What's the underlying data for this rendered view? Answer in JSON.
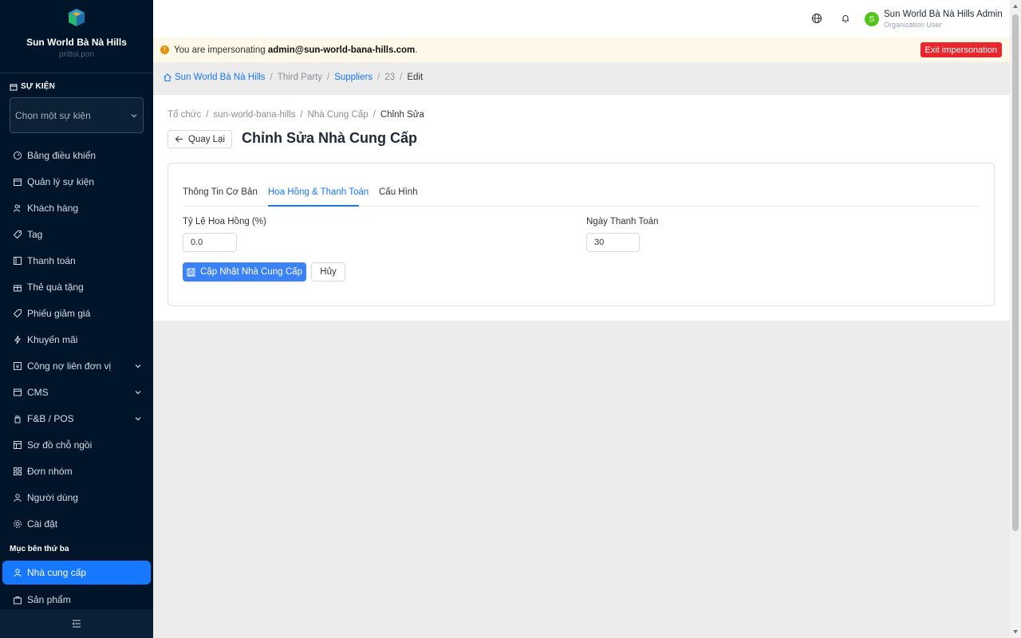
{
  "brand": {
    "name": "Sun World Bà Nà Hills",
    "sub": "prittoi.pon"
  },
  "event": {
    "section_label": "SỰ KIỆN",
    "select_placeholder": "Chọn một sự kiện"
  },
  "menu": {
    "items": [
      {
        "label": "Bảng điều khiển",
        "icon": "dashboard-icon"
      },
      {
        "label": "Quản lý sự kiện",
        "icon": "calendar-icon"
      },
      {
        "label": "Khách hàng",
        "icon": "users-icon"
      },
      {
        "label": "Tag",
        "icon": "tag-icon"
      },
      {
        "label": "Thanh toán",
        "icon": "payment-icon"
      },
      {
        "label": "Thẻ quà tặng",
        "icon": "gift-icon"
      },
      {
        "label": "Phiếu giảm giá",
        "icon": "coupon-icon"
      },
      {
        "label": "Khuyến mãi",
        "icon": "bolt-icon"
      },
      {
        "label": "Công nợ liên đơn vị",
        "icon": "ledger-icon"
      },
      {
        "label": "CMS",
        "icon": "cms-icon"
      },
      {
        "label": "F&B / POS",
        "icon": "hand-icon"
      },
      {
        "label": "Sơ đồ chỗ ngồi",
        "icon": "layout-icon"
      },
      {
        "label": "Đơn nhóm",
        "icon": "grid-icon"
      },
      {
        "label": "Người dùng",
        "icon": "user-icon"
      },
      {
        "label": "Cài đặt",
        "icon": "gear-icon"
      }
    ],
    "third_party_section": "Mục bên thứ ba",
    "third_party_items": [
      {
        "label": "Nhà cung cấp",
        "icon": "user-icon"
      },
      {
        "label": "Sản phẩm",
        "icon": "bag-icon"
      }
    ]
  },
  "header": {
    "user_initial": "S",
    "user_name": "Sun World Bà Nà Hills Admin",
    "user_role": "Organization User"
  },
  "impersonation": {
    "prefix": "You are impersonating ",
    "email": "admin@sun-world-bana-hills.com",
    "suffix": ".",
    "exit_label": "Exit impersonation"
  },
  "breadcrumb_top": {
    "home": "Sun World Bà Nà Hills",
    "third_party": "Third Party",
    "suppliers": "Suppliers",
    "id": "23",
    "edit": "Edit"
  },
  "breadcrumb_page": {
    "org": "Tổ chức",
    "slug": "sun-world-bana-hills",
    "suppliers": "Nhà Cung Cấp",
    "edit": "Chỉnh Sửa"
  },
  "page": {
    "back_label": "Quay Lại",
    "title": "Chỉnh Sửa Nhà Cung Cấp"
  },
  "tabs": [
    {
      "label": "Thông Tin Cơ Bản",
      "active": false
    },
    {
      "label": "Hoa Hồng & Thanh Toán",
      "active": true
    },
    {
      "label": "Cấu Hình",
      "active": false
    }
  ],
  "form": {
    "commission_label": "Tỷ Lệ Hoa Hồng (%)",
    "commission_value": "0.0",
    "payment_days_label": "Ngày Thanh Toán",
    "payment_days_value": "30",
    "submit_label": "Cập Nhật Nhà Cung Cấp",
    "cancel_label": "Hủy"
  },
  "colors": {
    "sidebar_bg": "#001529",
    "accent": "#1677ff",
    "danger": "#e8262e",
    "warning_bg": "#fdf8e8"
  }
}
